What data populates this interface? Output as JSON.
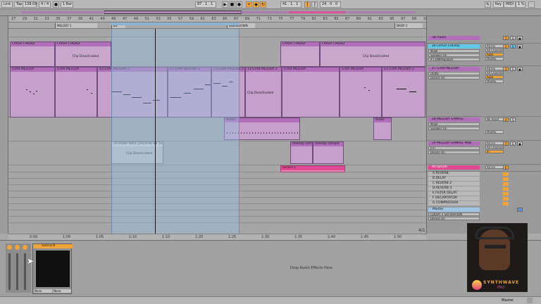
{
  "transport": {
    "link": "Link",
    "tap": "Tap",
    "tempo": "138.00",
    "time_sig": "4 / 4",
    "metro": "1 Bar",
    "position": "87 . 1 . 1",
    "loop_start": "41 . 1 . 1",
    "loop_len": "24 . 0 . 0",
    "key": "Key",
    "midi": "MIDI",
    "cpu": "1 %"
  },
  "ruler": {
    "ticks": [
      "27",
      "29",
      "31",
      "33",
      "35",
      "37",
      "39",
      "41",
      "43",
      "45",
      "47",
      "49",
      "51",
      "53",
      "55",
      "57",
      "59",
      "61",
      "63",
      "65",
      "67",
      "69",
      "71",
      "73",
      "75",
      "77",
      "79",
      "81",
      "83",
      "85",
      "87",
      "89",
      "91",
      "93",
      "95",
      "97",
      "99",
      "101"
    ],
    "time_ticks": [
      "0:56",
      "1:00",
      "1:05",
      "1:10",
      "1:15",
      "1:20",
      "1:25",
      "1:30",
      "1:35",
      "1:40",
      "1:45",
      "1:50"
    ]
  },
  "locators": [
    "MELODY 1",
    "BS",
    "BREAKDOWN",
    "DROP 2"
  ],
  "clips": {
    "layer_chord": "LAYER CHORD",
    "clip_deactivated": "Clip Deactivated",
    "star_melody": "STAR MELODY",
    "star_melody_2": "13 STAR MELODY 2",
    "audio": "Audio",
    "audio_clip": "24-Audio 0001 [2024-06-08 124539]",
    "melody_sample": "melody sample",
    "serum": "Serum 1",
    "deactivated_pair": "Clip Deactivated"
  },
  "page_fraction": "4/1",
  "mixer": {
    "tracks": [
      {
        "name": "3B Audio",
        "color": "#b06fb8"
      },
      {
        "name": "26 LAYER CHORD",
        "color": "#63c7e8",
        "dev1": "Mixer",
        "dev2": "Speaker On",
        "dev3": "X COMPRESSOR"
      },
      {
        "name": "27 STAR MELODY",
        "color": "#b06fb8",
        "dev1": "Utility",
        "dev2": "Device On"
      },
      {
        "name": "28 MELODY SAMPLE",
        "color": "#b06fb8",
        "dev1": "Mixer",
        "dev2": "Speaker On"
      },
      {
        "name": "29 MELODY SAMPLE MIDI",
        "color": "#b06fb8",
        "dev1": "OTT",
        "dev2": "Device On"
      },
      {
        "name": "All Serum",
        "color": "#e04a94"
      }
    ],
    "returns": [
      "A REVERB",
      "B DELAY",
      "C REVERB 2",
      "D REVERB 3",
      "E FILTER DELAY",
      "F DECAPITATOR",
      "G COMPRESSOR"
    ],
    "master": "Master",
    "master_dev1": "COLOR + SATURATION",
    "master_dev2": "Device On",
    "io": [
      "All Ins",
      "All Channels",
      "Auto",
      "In",
      "Master",
      "No Input"
    ]
  },
  "detail": {
    "device_title": "Gonna B",
    "drop_hint": "Drop Audio Effects Here",
    "none1": "None",
    "none2": "None"
  },
  "webcam": {
    "brand1": "SYNTHWAVE",
    "brand2": "PRO"
  },
  "statusbar": {
    "track": "Master"
  },
  "colors": {
    "purple": "#b06fb8",
    "cyan": "#63c7e8",
    "pink": "#e04a94",
    "orange": "#f0a43a",
    "loop": "#8fb2d2"
  }
}
